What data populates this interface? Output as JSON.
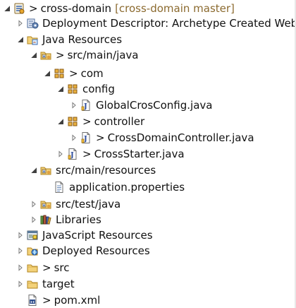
{
  "tree": {
    "rows": [
      {
        "level": 0,
        "toggle": "expanded",
        "icon": "project-icon",
        "prefix": ">",
        "label": "cross-domain",
        "decoration": "[cross-domain master]"
      },
      {
        "level": 1,
        "toggle": "collapsed",
        "icon": "deployment-descriptor-icon",
        "prefix": "",
        "label": "Deployment Descriptor: Archetype Created Web",
        "decoration": ""
      },
      {
        "level": 1,
        "toggle": "expanded",
        "icon": "java-resources-icon",
        "prefix": "",
        "label": "Java Resources",
        "decoration": ""
      },
      {
        "level": 2,
        "toggle": "expanded",
        "icon": "source-folder-icon",
        "prefix": ">",
        "label": "src/main/java",
        "decoration": ""
      },
      {
        "level": 3,
        "toggle": "expanded",
        "icon": "package-icon",
        "prefix": ">",
        "label": "com",
        "decoration": ""
      },
      {
        "level": 4,
        "toggle": "expanded",
        "icon": "package-icon",
        "prefix": "",
        "label": "config",
        "decoration": ""
      },
      {
        "level": 5,
        "toggle": "collapsed",
        "icon": "java-file-icon",
        "prefix": "",
        "label": "GlobalCrosConfig.java",
        "decoration": ""
      },
      {
        "level": 4,
        "toggle": "expanded",
        "icon": "package-icon",
        "prefix": ">",
        "label": "controller",
        "decoration": ""
      },
      {
        "level": 5,
        "toggle": "collapsed",
        "icon": "java-file-icon",
        "prefix": ">",
        "label": "CrossDomainController.java",
        "decoration": ""
      },
      {
        "level": 4,
        "toggle": "collapsed",
        "icon": "java-file-icon",
        "prefix": ">",
        "label": "CrossStarter.java",
        "decoration": ""
      },
      {
        "level": 2,
        "toggle": "expanded",
        "icon": "source-folder-icon",
        "prefix": "",
        "label": "src/main/resources",
        "decoration": ""
      },
      {
        "level": 3,
        "toggle": "none",
        "icon": "properties-file-icon",
        "prefix": "",
        "label": "application.properties",
        "decoration": ""
      },
      {
        "level": 2,
        "toggle": "collapsed",
        "icon": "source-folder-icon",
        "prefix": "",
        "label": "src/test/java",
        "decoration": ""
      },
      {
        "level": 2,
        "toggle": "collapsed",
        "icon": "libraries-icon",
        "prefix": "",
        "label": "Libraries",
        "decoration": ""
      },
      {
        "level": 1,
        "toggle": "collapsed",
        "icon": "javascript-resources-icon",
        "prefix": "",
        "label": "JavaScript Resources",
        "decoration": ""
      },
      {
        "level": 1,
        "toggle": "collapsed",
        "icon": "deployed-resources-icon",
        "prefix": "",
        "label": "Deployed Resources",
        "decoration": ""
      },
      {
        "level": 1,
        "toggle": "collapsed",
        "icon": "folder-icon",
        "prefix": ">",
        "label": "src",
        "decoration": ""
      },
      {
        "level": 1,
        "toggle": "collapsed",
        "icon": "folder-icon",
        "prefix": "",
        "label": "target",
        "decoration": ""
      },
      {
        "level": 1,
        "toggle": "none",
        "icon": "xml-file-icon",
        "prefix": ">",
        "label": "pom.xml",
        "decoration": ""
      }
    ]
  }
}
